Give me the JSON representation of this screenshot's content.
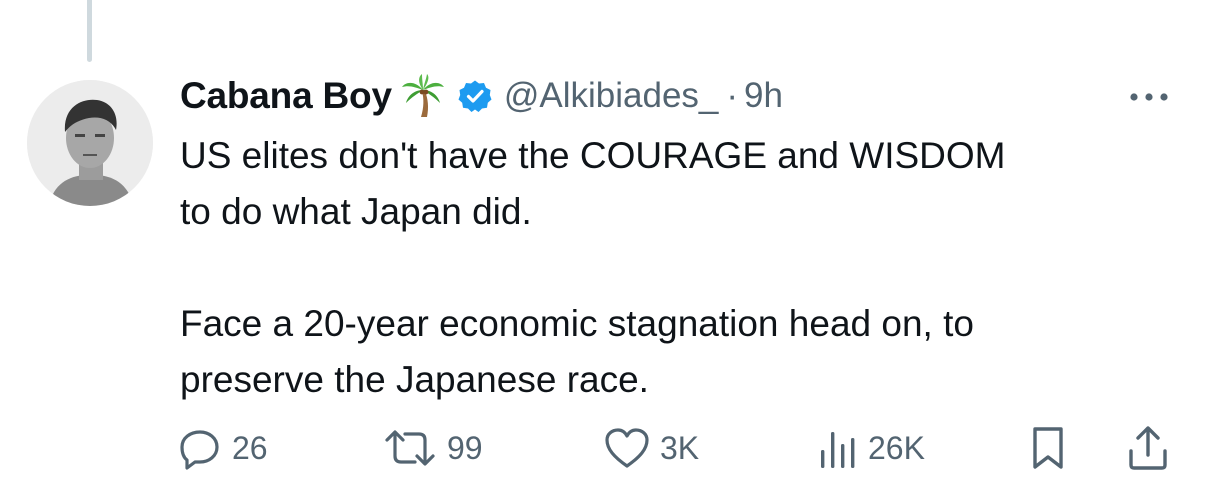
{
  "tweet": {
    "display_name": "Cabana Boy",
    "name_emoji": "palm-tree",
    "handle": "@Alkibiades_",
    "separator": "·",
    "time": "9h",
    "text_line_1": "US elites don't have the COURAGE and WISDOM",
    "text_line_2": "to do what Japan did.",
    "text_line_3": "Face a 20-year economic stagnation head on, to",
    "text_line_4": "preserve the Japanese race."
  },
  "actions": {
    "replies": "26",
    "reposts": "99",
    "likes": "3K",
    "views": "26K"
  },
  "colors": {
    "text": "#0f1419",
    "secondary": "#536471",
    "verified": "#1d9bf0",
    "thread_line": "#cfd9de"
  },
  "icons": {
    "more": "more-horizontal-icon",
    "reply": "reply-icon",
    "repost": "repost-icon",
    "like": "heart-icon",
    "views": "views-chart-icon",
    "bookmark": "bookmark-icon",
    "share": "share-icon"
  }
}
